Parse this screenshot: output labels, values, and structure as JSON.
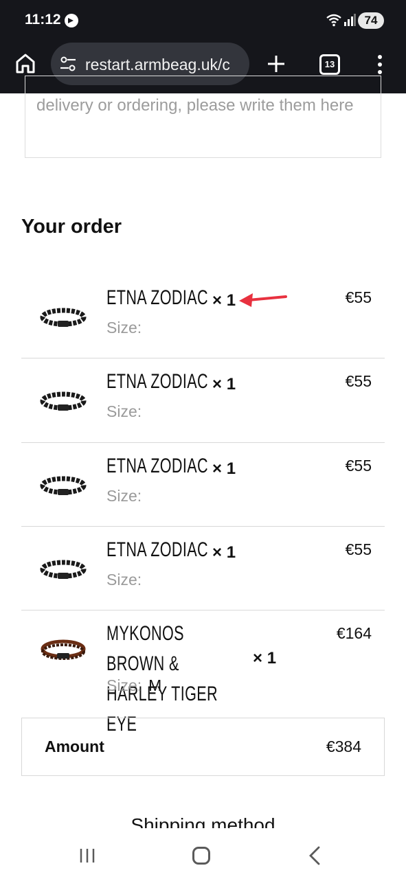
{
  "status_bar": {
    "time": "11:12",
    "battery": "74"
  },
  "browser": {
    "url": "restart.armbeag.uk/c",
    "tab_count": "13"
  },
  "notes": {
    "placeholder_text": "delivery or ordering, please write them here"
  },
  "order": {
    "heading": "Your order",
    "qty_prefix": "×",
    "size_label": "Size:",
    "items": [
      {
        "name": "ETNA ZODIAC",
        "qty": "1",
        "price": "€55",
        "size": "",
        "thumb": "black-bead-bracelet"
      },
      {
        "name": "ETNA ZODIAC",
        "qty": "1",
        "price": "€55",
        "size": "",
        "thumb": "black-bead-bracelet"
      },
      {
        "name": "ETNA ZODIAC",
        "qty": "1",
        "price": "€55",
        "size": "",
        "thumb": "black-bead-bracelet"
      },
      {
        "name": "ETNA ZODIAC",
        "qty": "1",
        "price": "€55",
        "size": "",
        "thumb": "black-bead-bracelet"
      },
      {
        "name": "MYKONOS BROWN & HARLEY TIGER EYE",
        "qty": "1",
        "price": "€164",
        "size": "M",
        "thumb": "brown-leather-bracelet"
      }
    ]
  },
  "amount": {
    "label": "Amount",
    "value": "€384"
  },
  "shipping": {
    "heading": "Shipping method"
  },
  "colors": {
    "chrome_bg": "#15161b",
    "url_pill": "#33353c",
    "annotation_arrow": "#e8313f",
    "muted_text": "#9a9a9a"
  }
}
